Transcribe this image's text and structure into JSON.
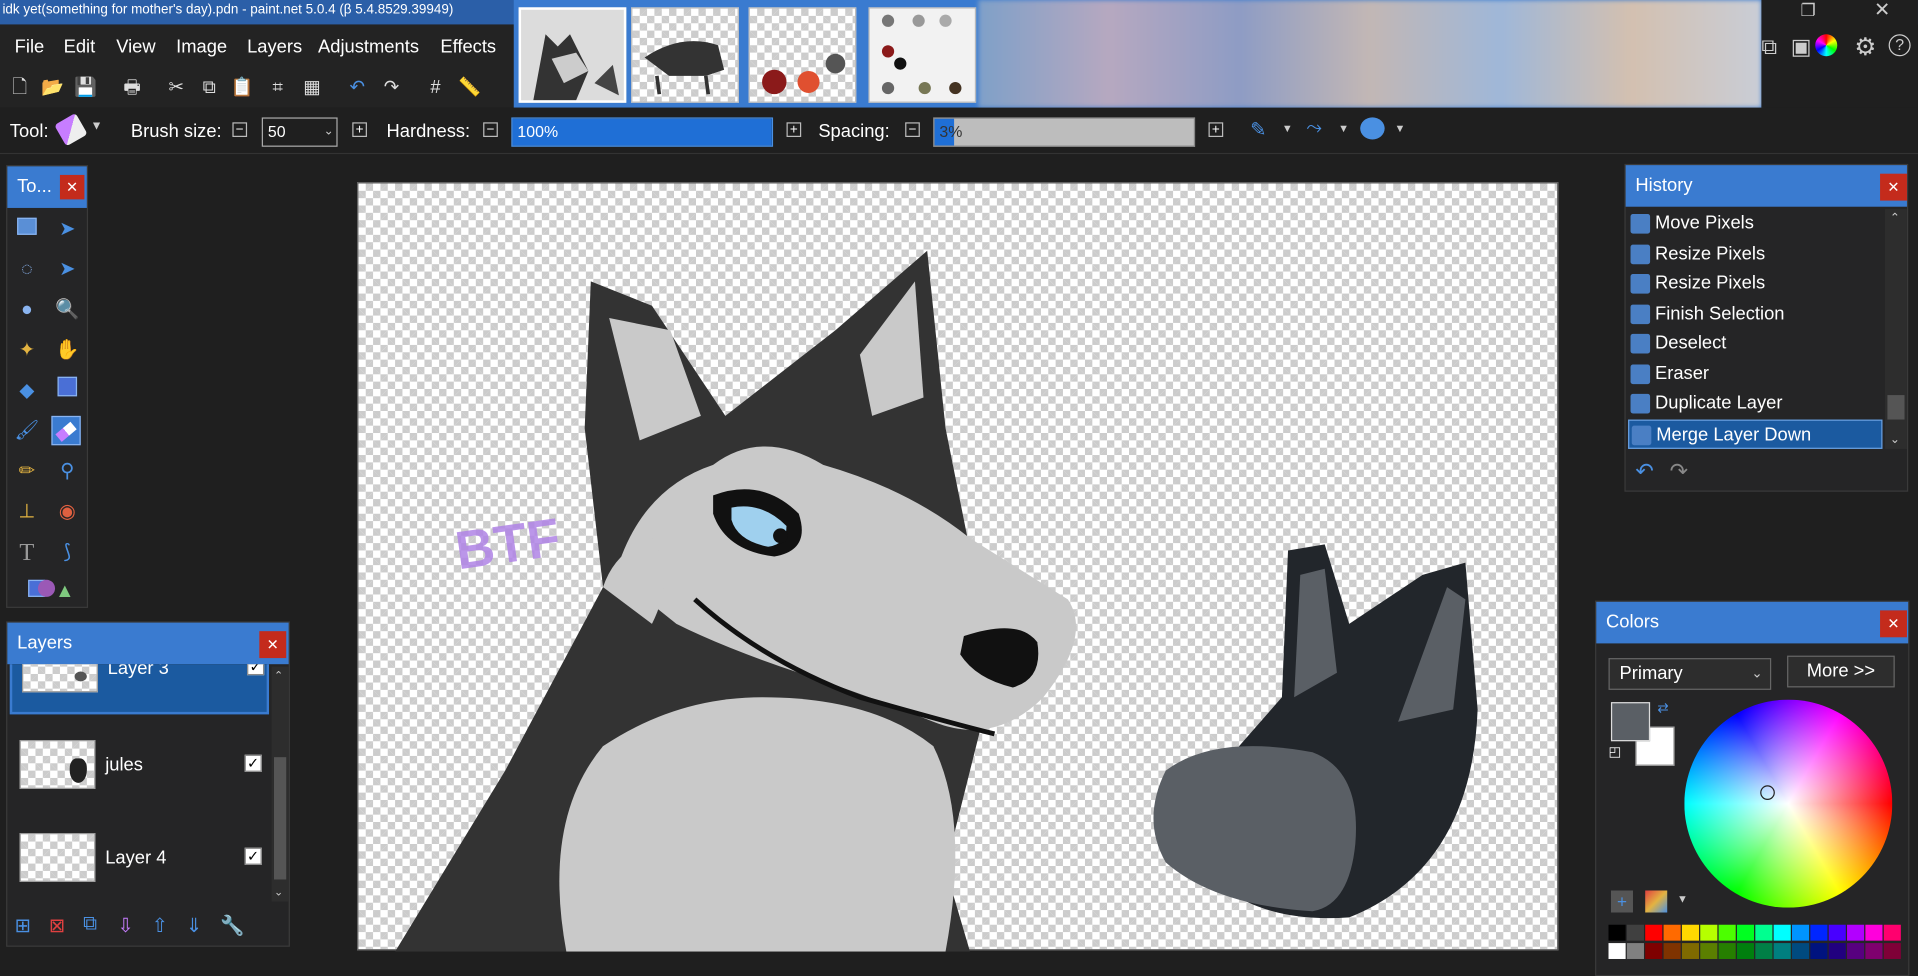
{
  "window": {
    "title": "idk yet(something for mother's day).pdn - paint.net 5.0.4 (β 5.4.8529.39949)"
  },
  "menu": [
    "File",
    "Edit",
    "View",
    "Image",
    "Layers",
    "Adjustments",
    "Effects"
  ],
  "toolbar": {
    "tool_label": "Tool:",
    "brush_label": "Brush size:",
    "brush_value": "50",
    "hardness_label": "Hardness:",
    "hardness_value": "100%",
    "spacing_label": "Spacing:",
    "spacing_value": "3%",
    "hardness_pct": 100,
    "spacing_pct": 3
  },
  "tools": {
    "title": "To..."
  },
  "history": {
    "title": "History",
    "items": [
      "Move Pixels",
      "Resize Pixels",
      "Resize Pixels",
      "Finish Selection",
      "Deselect",
      "Eraser",
      "Duplicate Layer",
      "Merge Layer Down"
    ],
    "selected_index": 7
  },
  "layers": {
    "title": "Layers",
    "items": [
      {
        "name": "Layer 3",
        "visible": true,
        "selected": true
      },
      {
        "name": "jules",
        "visible": true,
        "selected": false
      },
      {
        "name": "Layer 4",
        "visible": true,
        "selected": false
      }
    ]
  },
  "colors": {
    "title": "Colors",
    "mode": "Primary",
    "more_label": "More >>",
    "primary": "#5a5f65",
    "secondary": "#ffffff"
  },
  "canvas": {
    "text": "BTF"
  },
  "palette": {
    "row1": [
      "#000000",
      "#404040",
      "#ff0000",
      "#ff6a00",
      "#ffd800",
      "#b6ff00",
      "#4cff00",
      "#00ff21",
      "#00ff90",
      "#00ffff",
      "#0094ff",
      "#0026ff",
      "#4800ff",
      "#b200ff",
      "#ff00dc",
      "#ff006e"
    ],
    "row2": [
      "#ffffff",
      "#808080",
      "#7f0000",
      "#7f3300",
      "#7f6a00",
      "#5b7f00",
      "#267f00",
      "#007f0e",
      "#007f46",
      "#007f7f",
      "#004a7f",
      "#00137f",
      "#21007f",
      "#57007f",
      "#7f006e",
      "#7f0037"
    ]
  }
}
